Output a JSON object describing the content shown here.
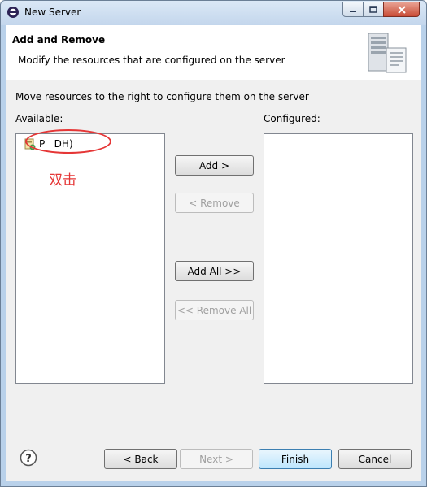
{
  "window": {
    "title": "New Server",
    "icons": {
      "app": "eclipse-icon",
      "minimize": "minimize-icon",
      "maximize": "maximize-icon",
      "close": "close-icon"
    }
  },
  "header": {
    "title": "Add and Remove",
    "description": "Modify the resources that are configured on the server",
    "icon": "server-icon"
  },
  "content": {
    "instruction": "Move resources to the right to configure them on the server",
    "available_label": "Available:",
    "configured_label": "Configured:",
    "available_items": [
      {
        "label": "P   DH)",
        "icon": "web-project-icon"
      }
    ],
    "annotation": "双击",
    "annotation_color": "#e53636"
  },
  "buttons": {
    "add": "Add >",
    "remove": "< Remove",
    "add_all": "Add All >>",
    "remove_all": "<< Remove All"
  },
  "footer": {
    "help_icon": "help-icon",
    "back": "< Back",
    "next": "Next >",
    "finish": "Finish",
    "cancel": "Cancel"
  }
}
